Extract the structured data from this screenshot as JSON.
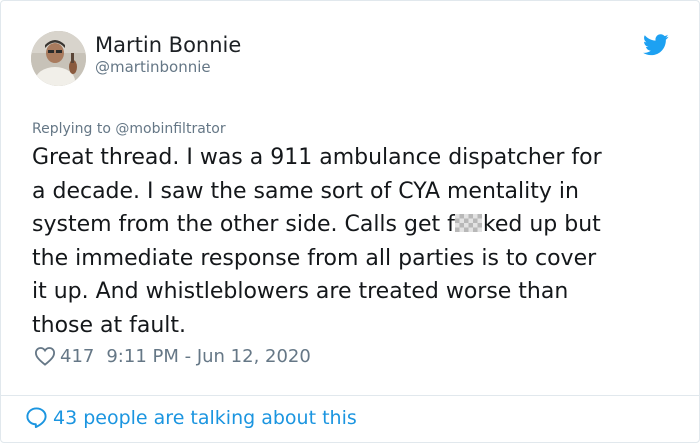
{
  "author": {
    "name": "Martin Bonnie",
    "handle": "@martinbonnie"
  },
  "reply": {
    "prefix": "Replying to ",
    "mention": "@mobinfiltrator"
  },
  "tweet": {
    "line1": "Great thread. I was a 911 ambulance dispatcher for",
    "line2": "a decade. I saw the same sort of CYA mentality in",
    "line3_before": "system from the other side. Calls get f",
    "line3_after": "ked up but",
    "line4": "the immediate response from all parties is to cover",
    "line5": "it up. And whistleblowers are treated worse than",
    "line6": "those at fault."
  },
  "meta": {
    "likes": "417",
    "timestamp": "9:11 PM - Jun 12, 2020"
  },
  "footer": {
    "talking": "43 people are talking about this"
  },
  "colors": {
    "accent": "#1b95e0",
    "twitter_blue": "#1da1f2",
    "secondary_text": "#657786",
    "border": "#e1e8ed"
  },
  "icons": {
    "brand": "twitter-bird-icon",
    "like": "heart-icon",
    "conversation": "speech-bubble-icon"
  }
}
